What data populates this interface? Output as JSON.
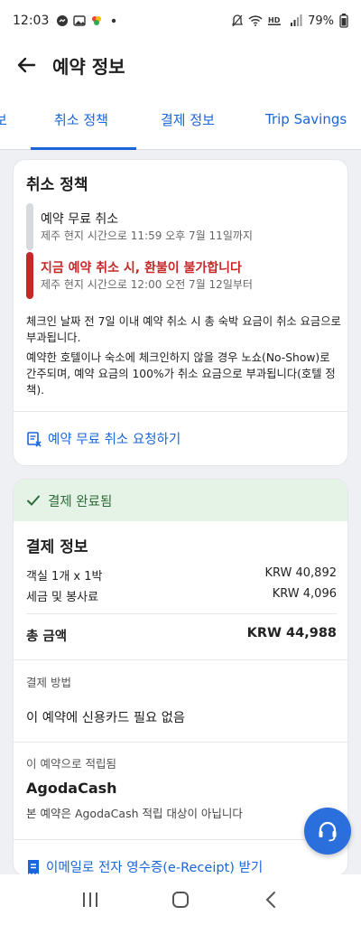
{
  "status": {
    "time": "12:03",
    "battery": "79%"
  },
  "header": {
    "title": "예약 정보"
  },
  "tabs": [
    {
      "label": "보"
    },
    {
      "label": "취소 정책"
    },
    {
      "label": "결제 정보"
    },
    {
      "label": "Trip Savings"
    }
  ],
  "policy": {
    "title": "취소 정책",
    "free_cancel_label": "예약 무료 취소",
    "free_cancel_time": "제주 현지 시간으로 11:59 오후 7월 11일까지",
    "no_refund_label": "지금 예약 취소 시, 환불이 불가합니다",
    "no_refund_time": "제주 현지 시간으로 12:00 오전 7월 12일부터",
    "para1": "체크인 날짜 전 7일 이내 예약 취소 시 총 숙박 요금이 취소 요금으로 부과됩니다.",
    "para2": "예약한 호텔이나 숙소에 체크인하지 않을 경우 노쇼(No-Show)로 간주되며, 예약 요금의 100%가 취소 요금으로 부과됩니다(호텔 정책).",
    "cancel_link": "예약 무료 취소 요청하기"
  },
  "payment": {
    "status": "결제 완료됨",
    "title": "결제 정보",
    "rows": [
      {
        "label": "객실 1개 x 1박",
        "value": "KRW 40,892"
      },
      {
        "label": "세금 및 봉사료",
        "value": "KRW 4,096"
      }
    ],
    "total_label": "총 금액",
    "total_value": "KRW 44,988",
    "method_label": "결제 방법",
    "method_value": "이 예약에 신용카드 필요 없음",
    "earn_label": "이 예약으로 적립됨",
    "earn_brand": "AgodaCash",
    "earn_note": "본 예약은 AgodaCash 적립 대상이 아닙니다",
    "receipt_link": "이메일로 전자 영수증(e-Receipt) 받기"
  },
  "colors": {
    "accent": "#1a66d9",
    "danger": "#c62828",
    "success_bg": "#e4f3e6",
    "fab": "#2a6fdb"
  },
  "icons": [
    "back-arrow-icon",
    "check-icon",
    "cancel-document-icon",
    "receipt-icon",
    "headset-icon"
  ]
}
